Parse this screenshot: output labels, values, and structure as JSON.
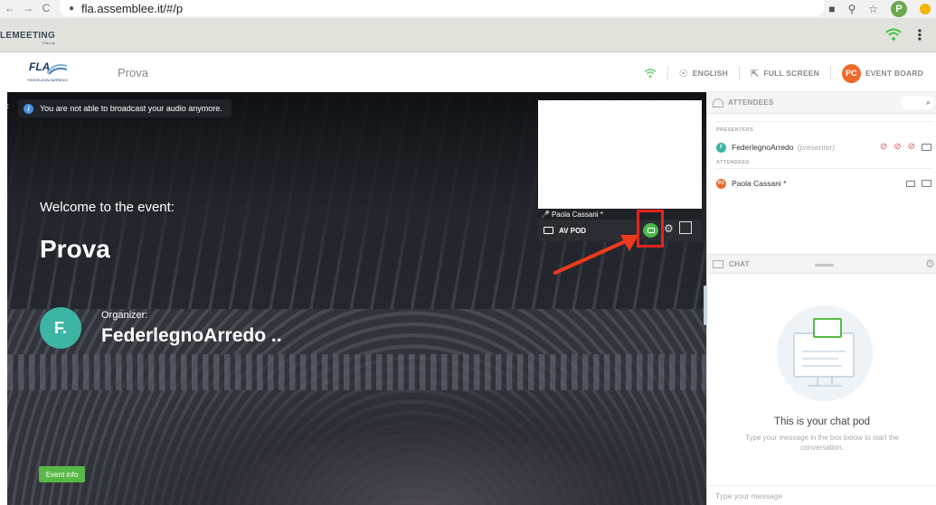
{
  "browser": {
    "url": "fla.assemblee.it/#/p",
    "profile_initial": "P",
    "nav_back": "←",
    "nav_forward": "→",
    "nav_reload": "C"
  },
  "app": {
    "logo_text": "LEMEETING",
    "logo_sub": "ITALIA",
    "menu_glyph": "⋮"
  },
  "header": {
    "brand_logo": "FLA",
    "brand_logo_sub": "FEDERLEGNOARREDO",
    "event_title": "Prova",
    "language": "ENGLISH",
    "full_screen": "FULL SCREEN",
    "event_board": "EVENT BOARD",
    "user_initials": "PC"
  },
  "stage": {
    "notice": "You are not able to broadcast your audio anymore.",
    "welcome": "Welcome to the event:",
    "event_name": "Prova",
    "organizer_label": "Organizer:",
    "organizer_name": "FederlegnoArredo ..",
    "organizer_initial": "F.",
    "event_info_button": "Event info"
  },
  "av_pod": {
    "title": "AV POD",
    "participant_name": "Paola Cassani *",
    "annotation_color": "#e8231c",
    "camera_active_color": "#4cb84a"
  },
  "attendees": {
    "header": "ATTENDEES",
    "search_icon": "⌕",
    "presenters_label": "PRESENTERS",
    "attendees_label": "ATTENDEES",
    "presenters": [
      {
        "initials": "F",
        "name": "FederlegnoArredo",
        "role": "(presenter)",
        "color": "#3cb5a5"
      }
    ],
    "attendees_list": [
      {
        "initials": "PC",
        "name": "Paola Cassani *",
        "color": "#ee6a2c"
      }
    ]
  },
  "chat": {
    "header": "CHAT",
    "gear_icon": "⚙",
    "empty_title": "This is your chat pod",
    "empty_subtitle": "Type your message in the box below to start the conversation.",
    "input_placeholder": "Type your message"
  }
}
